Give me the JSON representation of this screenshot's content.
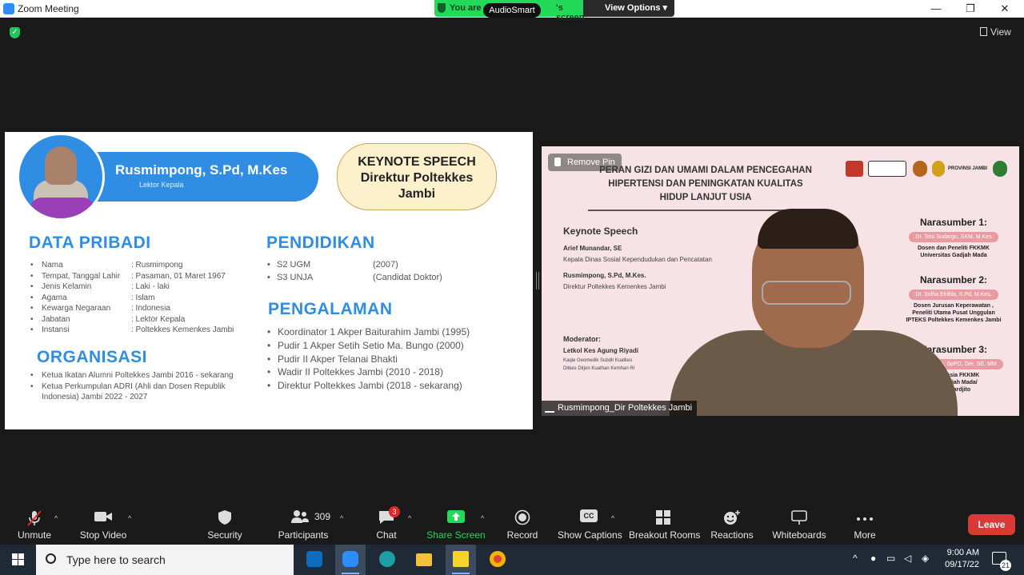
{
  "window": {
    "title": "Zoom Meeting",
    "minimize": "—",
    "restore": "❐",
    "close": "✕"
  },
  "share_banner": {
    "left_text": "You are",
    "right_text": "'s screen",
    "overlay_app": "AudioSmart",
    "view_options": "View Options ▾"
  },
  "view_button": "View",
  "slide": {
    "name": "Rusmimpong, S.Pd, M.Kes",
    "rank": "Lektor Kepala",
    "keynote_lines": [
      "KEYNOTE SPEECH",
      "Direktur Poltekkes",
      "Jambi"
    ],
    "data_pribadi_title": "DATA PRIBADI",
    "data_pribadi": [
      {
        "k": "Nama",
        "v": ": Rusmimpong"
      },
      {
        "k": "Tempat, Tanggal Lahir",
        "v": ": Pasaman, 01 Maret 1967"
      },
      {
        "k": "Jenis Kelamin",
        "v": ": Laki - laki"
      },
      {
        "k": "Agama",
        "v": ": Islam"
      },
      {
        "k": "Kewarga Negaraan",
        "v": ": Indonesia"
      },
      {
        "k": "Jabatan",
        "v": ": Lektor Kepala"
      },
      {
        "k": "Instansi",
        "v": ": Poltekkes Kemenkes Jambi"
      }
    ],
    "organisasi_title": "ORGANISASI",
    "organisasi": [
      "Ketua Ikatan Alumni Poltekkes Jambi 2016 - sekarang",
      "Ketua Perkumpulan ADRI (Ahli dan Dosen Republik Indonesia) Jambi 2022 - 2027"
    ],
    "pendidikan_title": "PENDIDIKAN",
    "pendidikan": [
      {
        "k": "S2 UGM",
        "v": "(2007)"
      },
      {
        "k": "S3 UNJA",
        "v": "(Candidat Doktor)"
      }
    ],
    "pengalaman_title": "PENGALAMAN",
    "pengalaman": [
      "Koordinator 1 Akper Baiturahim Jambi (1995)",
      "Pudir 1 Akper Setih Setio Ma. Bungo (2000)",
      "Pudir II Akper Telanai Bhakti",
      "Wadir II Poltekkes Jambi (2010 - 2018)",
      "Direktur Poltekkes Jambi (2018 - sekarang)"
    ]
  },
  "video": {
    "remove_pin": "Remove Pin",
    "title_lines": [
      "PERAN GIZI DAN UMAMI DALAM PENCEGAHAN",
      "HIPERTENSI DAN PENINGKATAN KUALITAS",
      "HIDUP LANJUT USIA"
    ],
    "provinsi": "PROVINSI JAMBI",
    "keynote_label": "Keynote Speech",
    "speaker1_name": "Arief Munandar, SE",
    "speaker1_role": "Kepala Dinas Sosial Kependudukan dan Pencatatan",
    "speaker2_name": "Rusmimpong, S.Pd, M.Kes.",
    "speaker2_role": "Direktur Poltekkes Kemenkes Jambi",
    "moderator_label": "Moderator:",
    "moderator_name": "Letkol Kes Agung Riyadi",
    "moderator_role1": "Kaqie Geomedik Subdit Kuatkes",
    "moderator_role2": "Ditkes Ditjen Kuathan Kemhan RI",
    "nara1": "Narasumber 1:",
    "nara1_pill": "Dr. Toto Sudargo, SKM, M.Kes",
    "nara1_desc": [
      "Dosen dan Peneliti FKKMK",
      "Universitas Gadjah Mada"
    ],
    "nara2": "Narasumber 2:",
    "nara2_pill": "Dr. Solha Elrifda, S.Pd, M.Kes.",
    "nara2_desc": [
      "Dosen Jurusan Keperawatan ,",
      "Peneliti Utama Pusat Unggulan",
      "IPTEKS Poltekkes Kemenkes Jambi"
    ],
    "nara3": "Narasumber 3:",
    "nara3_pill": "Probosuseno, SpPD, Ger, SE, MM",
    "nara3_desc": [
      "Ahli Lansia FKKMK",
      "itas Gadjah Mada/",
      "P Dr Sardjito"
    ],
    "participant_name": "Rusmimpong_Dir Poltekkes Jambi"
  },
  "toolbar": {
    "unmute": "Unmute",
    "stop_video": "Stop Video",
    "security": "Security",
    "participants": "Participants",
    "participants_count": "309",
    "chat": "Chat",
    "chat_badge": "3",
    "share_screen": "Share Screen",
    "record": "Record",
    "show_captions": "Show Captions",
    "cc": "CC",
    "breakout_rooms": "Breakout Rooms",
    "reactions": "Reactions",
    "whiteboards": "Whiteboards",
    "more": "More",
    "leave": "Leave"
  },
  "taskbar": {
    "search_placeholder": "Type here to search",
    "time": "9:00 AM",
    "date": "09/17/22",
    "notification_count": "21"
  },
  "colors": {
    "zoom_green": "#23d959",
    "slide_blue": "#2f8de4",
    "leave_red": "#d93a36",
    "taskbar": "#202a36"
  }
}
